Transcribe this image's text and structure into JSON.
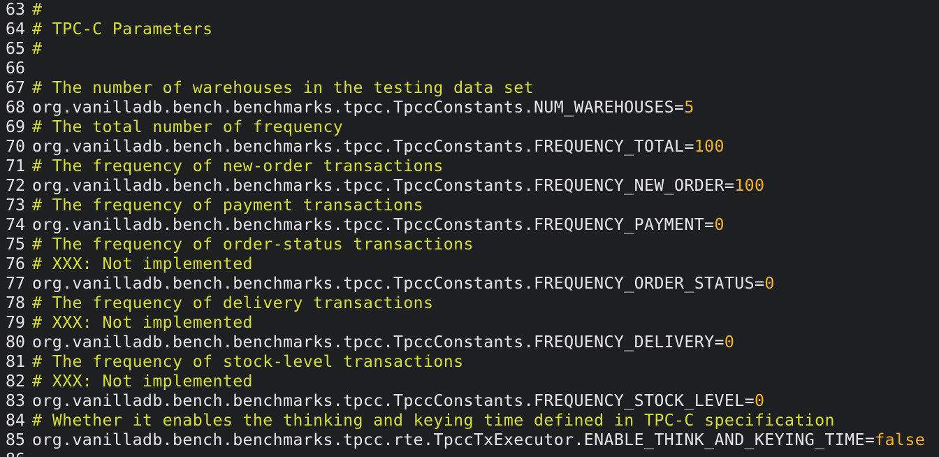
{
  "editor": {
    "colors": {
      "background": "#1d1f21",
      "text": "#e6e6e6",
      "comment": "#d6dd3a",
      "value": "#f2b233"
    },
    "lines": [
      {
        "num": "63",
        "type": "comment",
        "text": "#"
      },
      {
        "num": "64",
        "type": "comment",
        "text": "# TPC-C Parameters"
      },
      {
        "num": "65",
        "type": "comment",
        "text": "#"
      },
      {
        "num": "66",
        "type": "blank",
        "text": ""
      },
      {
        "num": "67",
        "type": "comment",
        "text": "# The number of warehouses in the testing data set"
      },
      {
        "num": "68",
        "type": "property",
        "key": "org.vanilladb.bench.benchmarks.tpcc.TpccConstants.NUM_WAREHOUSES",
        "value": "5"
      },
      {
        "num": "69",
        "type": "comment",
        "text": "# The total number of frequency"
      },
      {
        "num": "70",
        "type": "property",
        "key": "org.vanilladb.bench.benchmarks.tpcc.TpccConstants.FREQUENCY_TOTAL",
        "value": "100"
      },
      {
        "num": "71",
        "type": "comment",
        "text": "# The frequency of new-order transactions"
      },
      {
        "num": "72",
        "type": "property",
        "key": "org.vanilladb.bench.benchmarks.tpcc.TpccConstants.FREQUENCY_NEW_ORDER",
        "value": "100"
      },
      {
        "num": "73",
        "type": "comment",
        "text": "# The frequency of payment transactions"
      },
      {
        "num": "74",
        "type": "property",
        "key": "org.vanilladb.bench.benchmarks.tpcc.TpccConstants.FREQUENCY_PAYMENT",
        "value": "0"
      },
      {
        "num": "75",
        "type": "comment",
        "text": "# The frequency of order-status transactions"
      },
      {
        "num": "76",
        "type": "comment",
        "text": "# XXX: Not implemented"
      },
      {
        "num": "77",
        "type": "property",
        "key": "org.vanilladb.bench.benchmarks.tpcc.TpccConstants.FREQUENCY_ORDER_STATUS",
        "value": "0"
      },
      {
        "num": "78",
        "type": "comment",
        "text": "# The frequency of delivery transactions"
      },
      {
        "num": "79",
        "type": "comment",
        "text": "# XXX: Not implemented"
      },
      {
        "num": "80",
        "type": "property",
        "key": "org.vanilladb.bench.benchmarks.tpcc.TpccConstants.FREQUENCY_DELIVERY",
        "value": "0"
      },
      {
        "num": "81",
        "type": "comment",
        "text": "# The frequency of stock-level transactions"
      },
      {
        "num": "82",
        "type": "comment",
        "text": "# XXX: Not implemented"
      },
      {
        "num": "83",
        "type": "property",
        "key": "org.vanilladb.bench.benchmarks.tpcc.TpccConstants.FREQUENCY_STOCK_LEVEL",
        "value": "0"
      },
      {
        "num": "84",
        "type": "comment",
        "text": "# Whether it enables the thinking and keying time defined in TPC-C specification"
      },
      {
        "num": "85",
        "type": "property",
        "key": "org.vanilladb.bench.benchmarks.tpcc.rte.TpccTxExecutor.ENABLE_THINK_AND_KEYING_TIME",
        "value": "false"
      },
      {
        "num": "86",
        "type": "blank",
        "text": ""
      }
    ]
  }
}
